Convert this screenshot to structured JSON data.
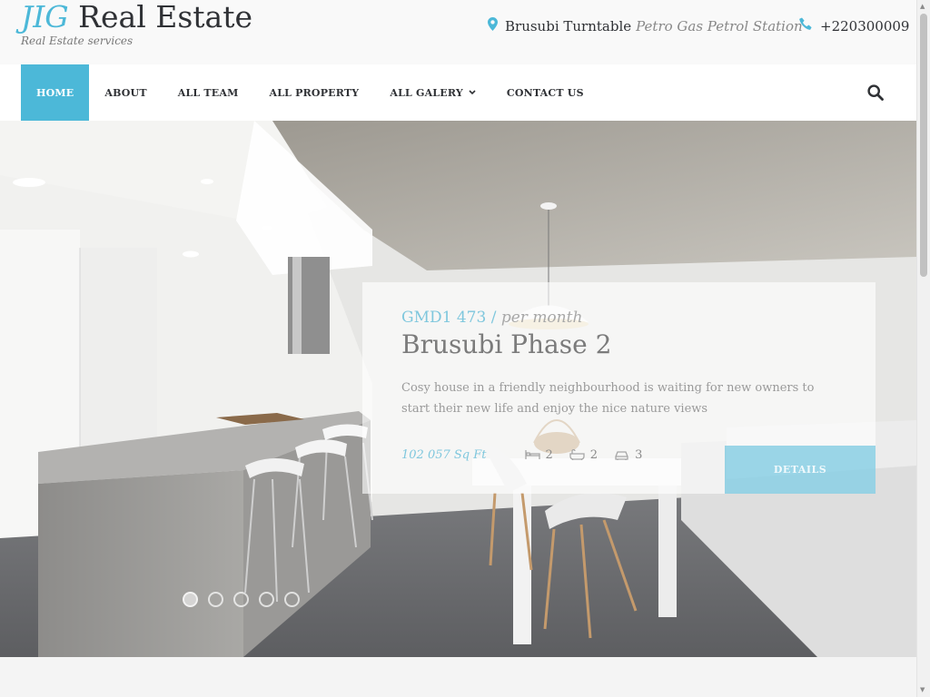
{
  "brand": {
    "logo_accent": "JIG",
    "logo_main": "Real Estate",
    "tagline": "Real Estate services",
    "accent_color": "#4cb8d8"
  },
  "contact": {
    "address_main": "Brusubi Turntable",
    "address_detail": "Petro Gas Petrol Station",
    "phone": "+220300009",
    "icons": [
      "map-pin-icon",
      "phone-icon"
    ]
  },
  "nav": {
    "items": [
      {
        "label": "HOME",
        "active": true
      },
      {
        "label": "ABOUT"
      },
      {
        "label": "ALL TEAM"
      },
      {
        "label": "ALL PROPERTY"
      },
      {
        "label": "ALL GALERY",
        "has_dropdown": true
      },
      {
        "label": "CONTACT US"
      }
    ],
    "search_icon": "search-icon"
  },
  "slide": {
    "price": "GMD1 473",
    "price_separator": " / ",
    "price_period": "per month",
    "title": "Brusubi Phase 2",
    "description": "Cosy house in a friendly neighbourhood is waiting for new owners to start their new life and enjoy the nice nature views",
    "area": "102 057 Sq Ft",
    "beds": "2",
    "baths": "2",
    "garages": "3",
    "details_label": "DETAILS",
    "slide_count": 5,
    "active_slide": 1
  }
}
